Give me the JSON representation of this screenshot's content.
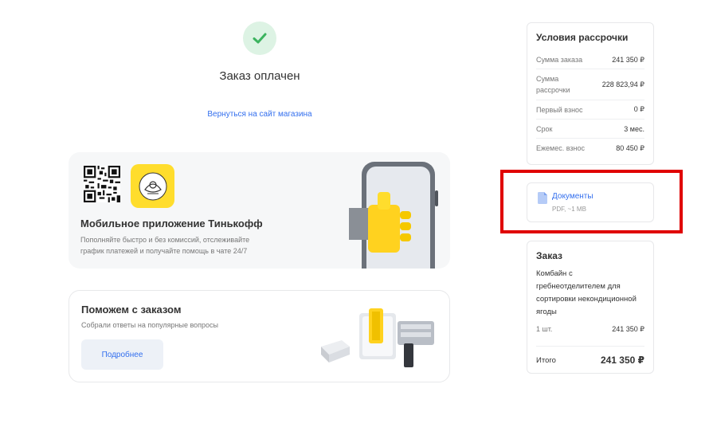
{
  "status": {
    "title": "Заказ оплачен",
    "back_link": "Вернуться на сайт магазина",
    "icon": "check-icon",
    "accent": "#336fee",
    "success_color": "#3cb35f"
  },
  "app_card": {
    "title": "Мобильное приложение Тинькофф",
    "description": "Пополняйте быстро и без комиссий, отслеживайте график платежей и получайте помощь в чате 24/7",
    "logo_color": "#ffdd2d"
  },
  "help_card": {
    "title": "Поможем с заказом",
    "description": "Собрали ответы на популярные вопросы",
    "button": "Подробнее"
  },
  "terms": {
    "title": "Условия рассрочки",
    "rows": [
      {
        "label": "Сумма заказа",
        "value": "241 350 ₽"
      },
      {
        "label": "Сумма рассрочки",
        "value": "228 823,94 ₽"
      },
      {
        "label": "Первый взнос",
        "value": "0 ₽"
      },
      {
        "label": "Срок",
        "value": "3 мес."
      },
      {
        "label": "Ежемес. взнос",
        "value": "80 450 ₽"
      }
    ]
  },
  "documents": {
    "link": "Документы",
    "meta": "PDF, ~1 MB"
  },
  "order": {
    "title": "Заказ",
    "item": "Комбайн с гребнеотделителем для сортировки некондиционной ягоды",
    "qty": "1 шт.",
    "qty_price": "241 350 ₽",
    "total_label": "Итого",
    "total_value": "241 350 ₽"
  },
  "highlight_color": "#e00000"
}
